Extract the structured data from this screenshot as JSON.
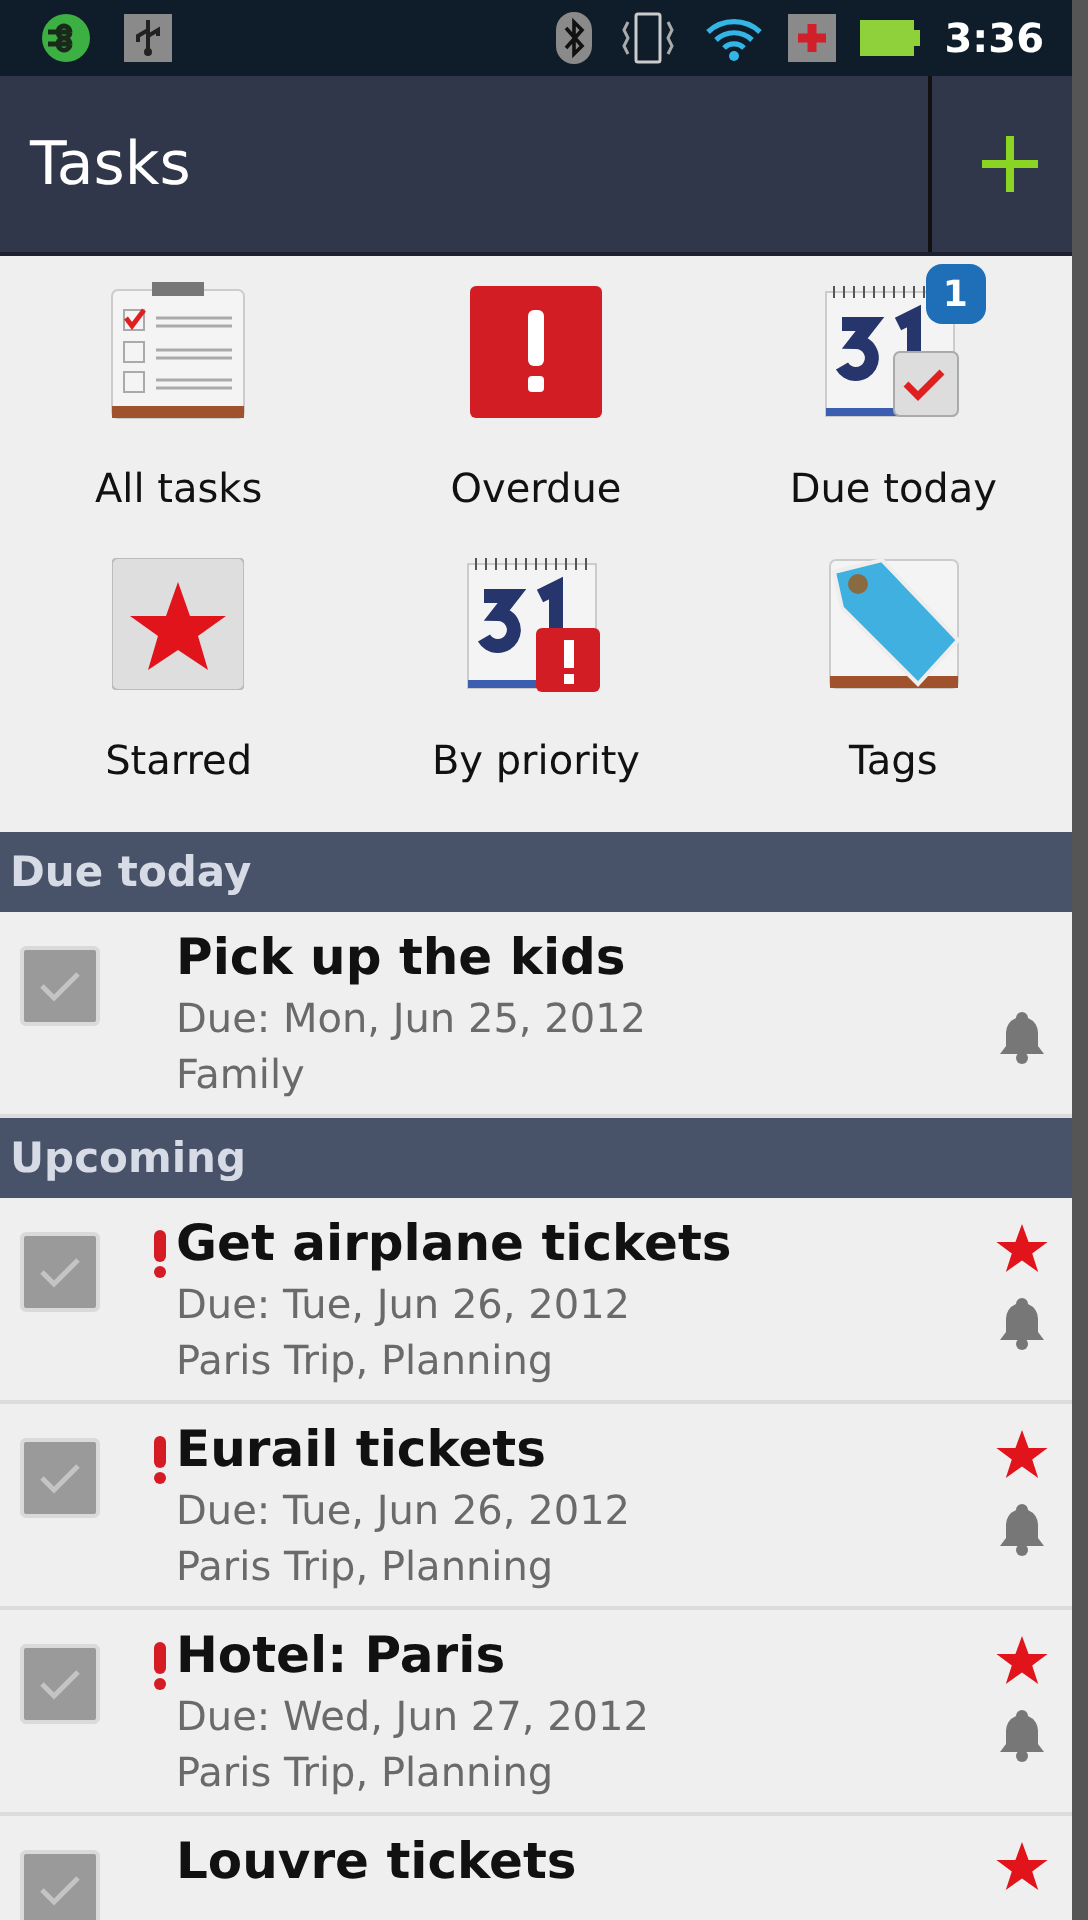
{
  "status_bar": {
    "time": "3:36"
  },
  "header": {
    "title": "Tasks"
  },
  "filters": [
    {
      "kind": "all",
      "label": "All tasks"
    },
    {
      "kind": "overdue",
      "label": "Overdue"
    },
    {
      "kind": "today",
      "label": "Due today",
      "badge": "1"
    },
    {
      "kind": "starred",
      "label": "Starred"
    },
    {
      "kind": "priority",
      "label": "By priority"
    },
    {
      "kind": "tags",
      "label": "Tags"
    }
  ],
  "sections": [
    {
      "title": "Due today",
      "tasks": [
        {
          "title": "Pick up the kids",
          "due": "Due: Mon, Jun 25, 2012",
          "tags": "Family",
          "checked": false,
          "important": false,
          "starred": false,
          "alarm": true
        }
      ]
    },
    {
      "title": "Upcoming",
      "tasks": [
        {
          "title": "Get airplane tickets",
          "due": "Due: Tue, Jun 26, 2012",
          "tags": "Paris Trip, Planning",
          "checked": false,
          "important": true,
          "starred": true,
          "alarm": true
        },
        {
          "title": "Eurail tickets",
          "due": "Due: Tue, Jun 26, 2012",
          "tags": "Paris Trip, Planning",
          "checked": false,
          "important": true,
          "starred": true,
          "alarm": true
        },
        {
          "title": "Hotel: Paris",
          "due": "Due: Wed, Jun 27, 2012",
          "tags": "Paris Trip, Planning",
          "checked": false,
          "important": true,
          "starred": true,
          "alarm": true
        },
        {
          "title": "Louvre tickets",
          "checked": false,
          "important": false,
          "starred": true,
          "alarm": false
        }
      ]
    }
  ]
}
